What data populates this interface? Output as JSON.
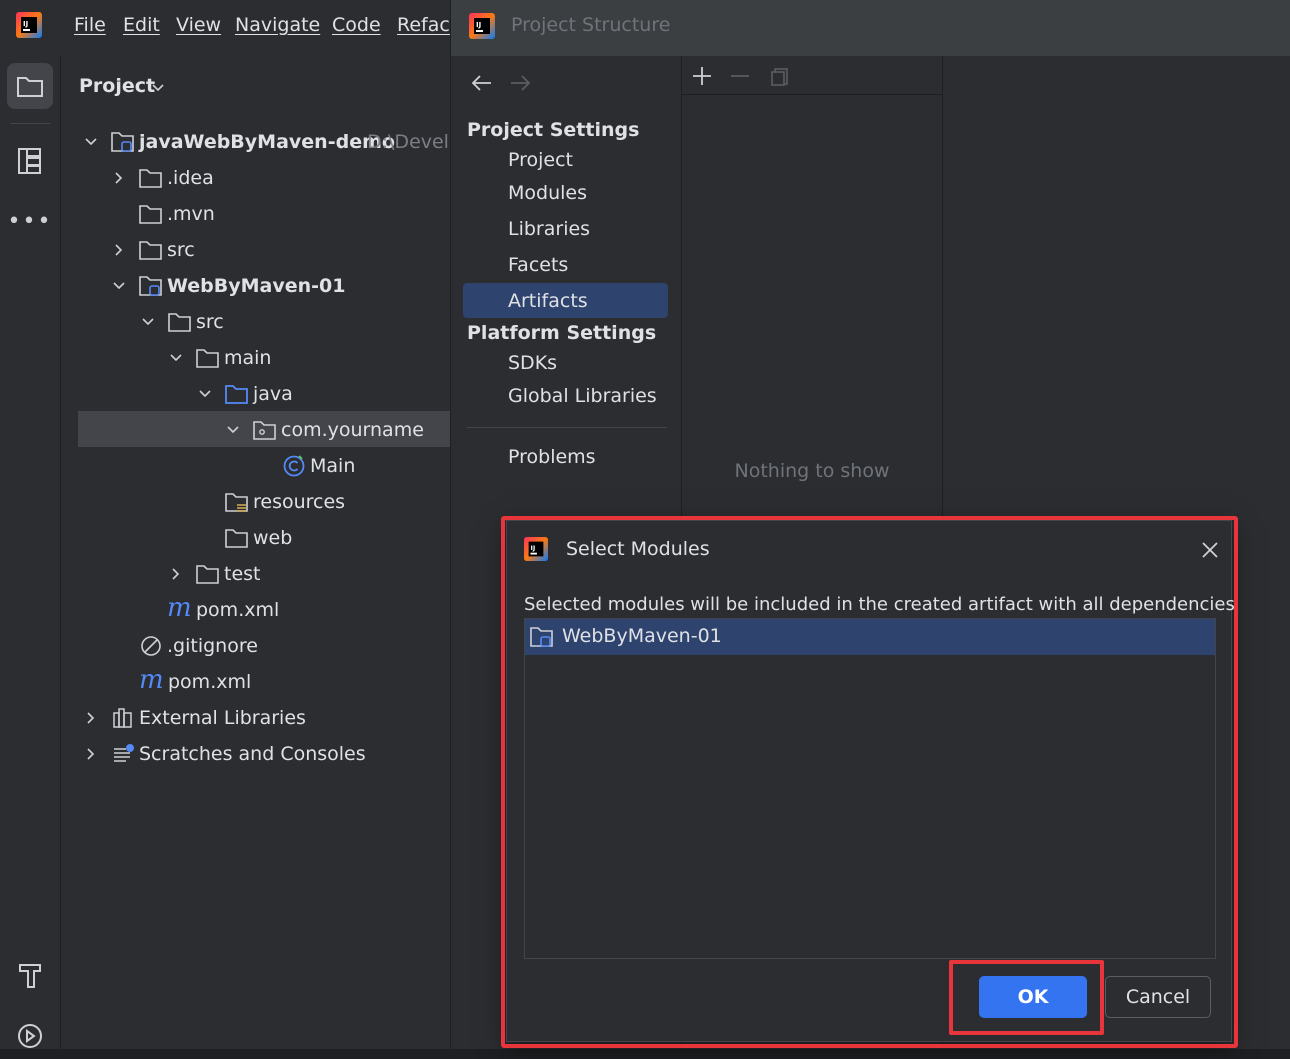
{
  "menu": {
    "items": [
      "File",
      "Edit",
      "View",
      "Navigate",
      "Code",
      "Refact"
    ]
  },
  "project_panel": {
    "title": "Project",
    "tree": [
      {
        "label": "javaWebByMaven-demo",
        "path": "D:\\Develo",
        "bold": true
      },
      {
        "label": ".idea"
      },
      {
        "label": ".mvn"
      },
      {
        "label": "src"
      },
      {
        "label": "WebByMaven-01",
        "bold": true
      },
      {
        "label": "src"
      },
      {
        "label": "main"
      },
      {
        "label": "java"
      },
      {
        "label": "com.yourname"
      },
      {
        "label": "Main"
      },
      {
        "label": "resources"
      },
      {
        "label": "web"
      },
      {
        "label": "test"
      },
      {
        "label": "pom.xml"
      },
      {
        "label": ".gitignore"
      },
      {
        "label": "pom.xml"
      },
      {
        "label": "External Libraries"
      },
      {
        "label": "Scratches and Consoles"
      }
    ]
  },
  "project_structure": {
    "title": "Project Structure",
    "project_settings_header": "Project Settings",
    "project_settings_items": [
      "Project",
      "Modules",
      "Libraries",
      "Facets",
      "Artifacts"
    ],
    "selected_item": "Artifacts",
    "platform_settings_header": "Platform Settings",
    "platform_settings_items": [
      "SDKs",
      "Global Libraries"
    ],
    "problems_label": "Problems",
    "empty_text": "Nothing to show"
  },
  "select_modules": {
    "title": "Select Modules",
    "description": "Selected modules will be included in the created artifact with all dependencies",
    "modules": [
      "WebByMaven-01"
    ],
    "ok_label": "OK",
    "cancel_label": "Cancel"
  },
  "colors": {
    "selection": "#2e436e",
    "accent": "#3574f0",
    "highlight_red": "#e7353b",
    "folder_blue": "#548af7"
  }
}
